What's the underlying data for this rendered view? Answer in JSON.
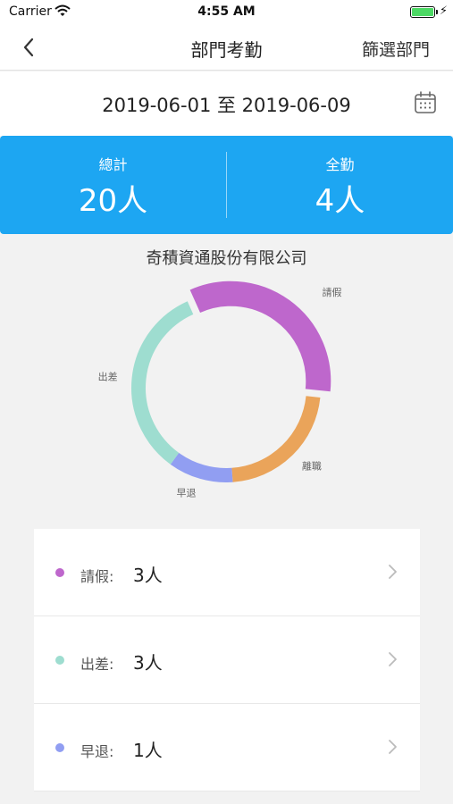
{
  "status_bar": {
    "carrier": "Carrier",
    "time": "4:55 AM"
  },
  "nav": {
    "title": "部門考勤",
    "filter_label": "篩選部門",
    "back_icon": "chevron-left-icon"
  },
  "date_range": {
    "text": "2019-06-01 至 2019-06-09",
    "calendar_icon": "calendar-icon"
  },
  "summary": {
    "total_label": "總計",
    "total_value": "20人",
    "full_label": "全勤",
    "full_value": "4人"
  },
  "company_name": "奇積資通股份有限公司",
  "chart_data": {
    "type": "pie",
    "style": "donut",
    "categories": [
      "請假",
      "離職",
      "早退",
      "出差"
    ],
    "values": [
      3,
      2,
      1,
      3
    ],
    "colors": [
      "#be67cc",
      "#eaa45a",
      "#919ef2",
      "#9eddd0"
    ],
    "highlighted": "請假"
  },
  "list": {
    "items": [
      {
        "label": "請假:",
        "value": "3人",
        "color": "#be67cc"
      },
      {
        "label": "出差:",
        "value": "3人",
        "color": "#9eddd0"
      },
      {
        "label": "早退:",
        "value": "1人",
        "color": "#919ef2"
      }
    ]
  }
}
